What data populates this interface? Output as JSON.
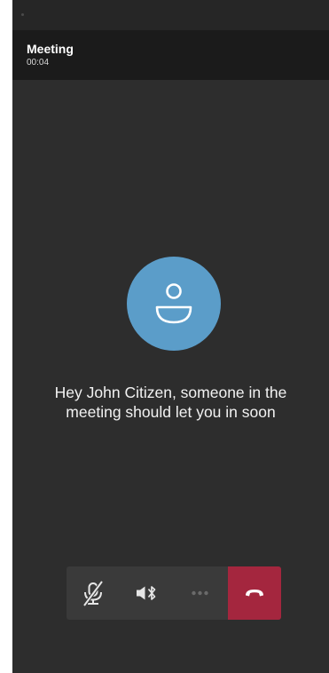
{
  "header": {
    "title": "Meeting",
    "timer": "00:04"
  },
  "lobby": {
    "message": "Hey John Citizen, someone in the\nmeeting should let you in soon"
  },
  "controls": [
    {
      "id": "mute",
      "icon": "microphone-off-icon"
    },
    {
      "id": "audio",
      "icon": "speaker-bluetooth-icon"
    },
    {
      "id": "more",
      "icon": "more-dots-icon"
    },
    {
      "id": "hangup",
      "icon": "phone-hangup-icon"
    }
  ],
  "colors": {
    "background": "#2d2d2d",
    "header": "#1b1b1b",
    "avatar": "#5b9dc9",
    "controls": "#3a3a3a",
    "hangup": "#a4263e"
  }
}
